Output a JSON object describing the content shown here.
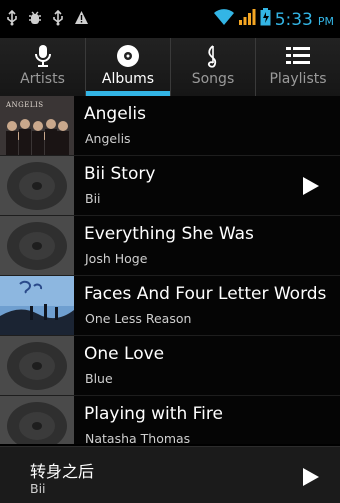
{
  "status_bar": {
    "time": "5:33",
    "ampm": "PM",
    "icons": [
      "usb-icon",
      "debug-icon",
      "usb-icon",
      "warning-icon",
      "wifi-icon",
      "signal-icon",
      "battery-icon"
    ]
  },
  "tabs": [
    {
      "label": "Artists",
      "icon": "microphone-icon",
      "active": false
    },
    {
      "label": "Albums",
      "icon": "album-disc-icon",
      "active": true
    },
    {
      "label": "Songs",
      "icon": "music-note-icon",
      "active": false
    },
    {
      "label": "Playlists",
      "icon": "playlist-icon",
      "active": false
    }
  ],
  "albums": [
    {
      "title": "Angelis",
      "artist": "Angelis",
      "art": "angelis-cover"
    },
    {
      "title": "Bii Story",
      "artist": "Bii",
      "art": "default-disc",
      "playing": true
    },
    {
      "title": "Everything She Was",
      "artist": "Josh Hoge",
      "art": "default-disc"
    },
    {
      "title": "Faces And Four Letter Words",
      "artist": "One Less Reason",
      "art": "one-less-reason-cover"
    },
    {
      "title": "One Love",
      "artist": "Blue",
      "art": "default-disc"
    },
    {
      "title": "Playing with Fire",
      "artist": "Natasha Thomas",
      "art": "default-disc"
    }
  ],
  "angelis_cover_text": "ANGELIS",
  "now_playing": {
    "title": "转身之后",
    "artist": "Bii"
  },
  "colors": {
    "accent": "#33b5e5",
    "background": "#000000",
    "signal": "#f5a623"
  }
}
